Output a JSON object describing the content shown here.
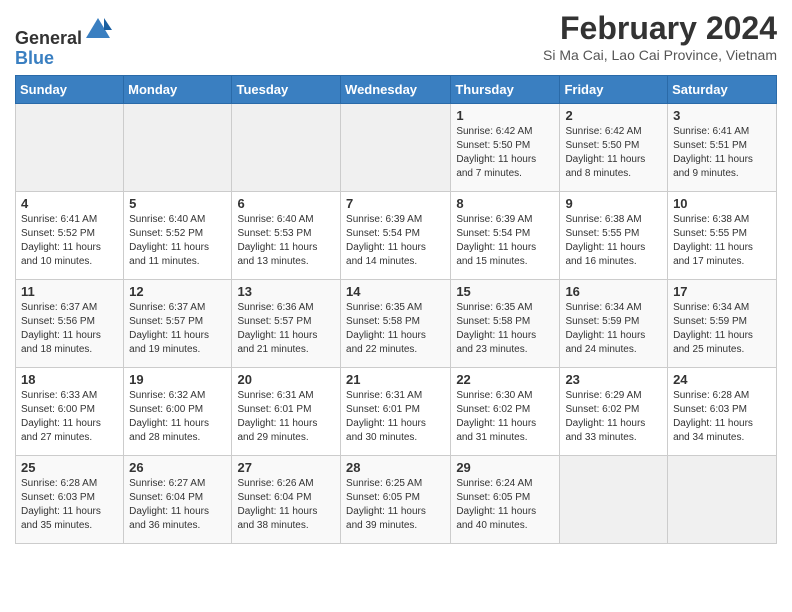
{
  "header": {
    "logo_general": "General",
    "logo_blue": "Blue",
    "title": "February 2024",
    "subtitle": "Si Ma Cai, Lao Cai Province, Vietnam"
  },
  "weekdays": [
    "Sunday",
    "Monday",
    "Tuesday",
    "Wednesday",
    "Thursday",
    "Friday",
    "Saturday"
  ],
  "weeks": [
    [
      {
        "day": "",
        "info": ""
      },
      {
        "day": "",
        "info": ""
      },
      {
        "day": "",
        "info": ""
      },
      {
        "day": "",
        "info": ""
      },
      {
        "day": "1",
        "info": "Sunrise: 6:42 AM\nSunset: 5:50 PM\nDaylight: 11 hours and 7 minutes."
      },
      {
        "day": "2",
        "info": "Sunrise: 6:42 AM\nSunset: 5:50 PM\nDaylight: 11 hours and 8 minutes."
      },
      {
        "day": "3",
        "info": "Sunrise: 6:41 AM\nSunset: 5:51 PM\nDaylight: 11 hours and 9 minutes."
      }
    ],
    [
      {
        "day": "4",
        "info": "Sunrise: 6:41 AM\nSunset: 5:52 PM\nDaylight: 11 hours and 10 minutes."
      },
      {
        "day": "5",
        "info": "Sunrise: 6:40 AM\nSunset: 5:52 PM\nDaylight: 11 hours and 11 minutes."
      },
      {
        "day": "6",
        "info": "Sunrise: 6:40 AM\nSunset: 5:53 PM\nDaylight: 11 hours and 13 minutes."
      },
      {
        "day": "7",
        "info": "Sunrise: 6:39 AM\nSunset: 5:54 PM\nDaylight: 11 hours and 14 minutes."
      },
      {
        "day": "8",
        "info": "Sunrise: 6:39 AM\nSunset: 5:54 PM\nDaylight: 11 hours and 15 minutes."
      },
      {
        "day": "9",
        "info": "Sunrise: 6:38 AM\nSunset: 5:55 PM\nDaylight: 11 hours and 16 minutes."
      },
      {
        "day": "10",
        "info": "Sunrise: 6:38 AM\nSunset: 5:55 PM\nDaylight: 11 hours and 17 minutes."
      }
    ],
    [
      {
        "day": "11",
        "info": "Sunrise: 6:37 AM\nSunset: 5:56 PM\nDaylight: 11 hours and 18 minutes."
      },
      {
        "day": "12",
        "info": "Sunrise: 6:37 AM\nSunset: 5:57 PM\nDaylight: 11 hours and 19 minutes."
      },
      {
        "day": "13",
        "info": "Sunrise: 6:36 AM\nSunset: 5:57 PM\nDaylight: 11 hours and 21 minutes."
      },
      {
        "day": "14",
        "info": "Sunrise: 6:35 AM\nSunset: 5:58 PM\nDaylight: 11 hours and 22 minutes."
      },
      {
        "day": "15",
        "info": "Sunrise: 6:35 AM\nSunset: 5:58 PM\nDaylight: 11 hours and 23 minutes."
      },
      {
        "day": "16",
        "info": "Sunrise: 6:34 AM\nSunset: 5:59 PM\nDaylight: 11 hours and 24 minutes."
      },
      {
        "day": "17",
        "info": "Sunrise: 6:34 AM\nSunset: 5:59 PM\nDaylight: 11 hours and 25 minutes."
      }
    ],
    [
      {
        "day": "18",
        "info": "Sunrise: 6:33 AM\nSunset: 6:00 PM\nDaylight: 11 hours and 27 minutes."
      },
      {
        "day": "19",
        "info": "Sunrise: 6:32 AM\nSunset: 6:00 PM\nDaylight: 11 hours and 28 minutes."
      },
      {
        "day": "20",
        "info": "Sunrise: 6:31 AM\nSunset: 6:01 PM\nDaylight: 11 hours and 29 minutes."
      },
      {
        "day": "21",
        "info": "Sunrise: 6:31 AM\nSunset: 6:01 PM\nDaylight: 11 hours and 30 minutes."
      },
      {
        "day": "22",
        "info": "Sunrise: 6:30 AM\nSunset: 6:02 PM\nDaylight: 11 hours and 31 minutes."
      },
      {
        "day": "23",
        "info": "Sunrise: 6:29 AM\nSunset: 6:02 PM\nDaylight: 11 hours and 33 minutes."
      },
      {
        "day": "24",
        "info": "Sunrise: 6:28 AM\nSunset: 6:03 PM\nDaylight: 11 hours and 34 minutes."
      }
    ],
    [
      {
        "day": "25",
        "info": "Sunrise: 6:28 AM\nSunset: 6:03 PM\nDaylight: 11 hours and 35 minutes."
      },
      {
        "day": "26",
        "info": "Sunrise: 6:27 AM\nSunset: 6:04 PM\nDaylight: 11 hours and 36 minutes."
      },
      {
        "day": "27",
        "info": "Sunrise: 6:26 AM\nSunset: 6:04 PM\nDaylight: 11 hours and 38 minutes."
      },
      {
        "day": "28",
        "info": "Sunrise: 6:25 AM\nSunset: 6:05 PM\nDaylight: 11 hours and 39 minutes."
      },
      {
        "day": "29",
        "info": "Sunrise: 6:24 AM\nSunset: 6:05 PM\nDaylight: 11 hours and 40 minutes."
      },
      {
        "day": "",
        "info": ""
      },
      {
        "day": "",
        "info": ""
      }
    ]
  ]
}
